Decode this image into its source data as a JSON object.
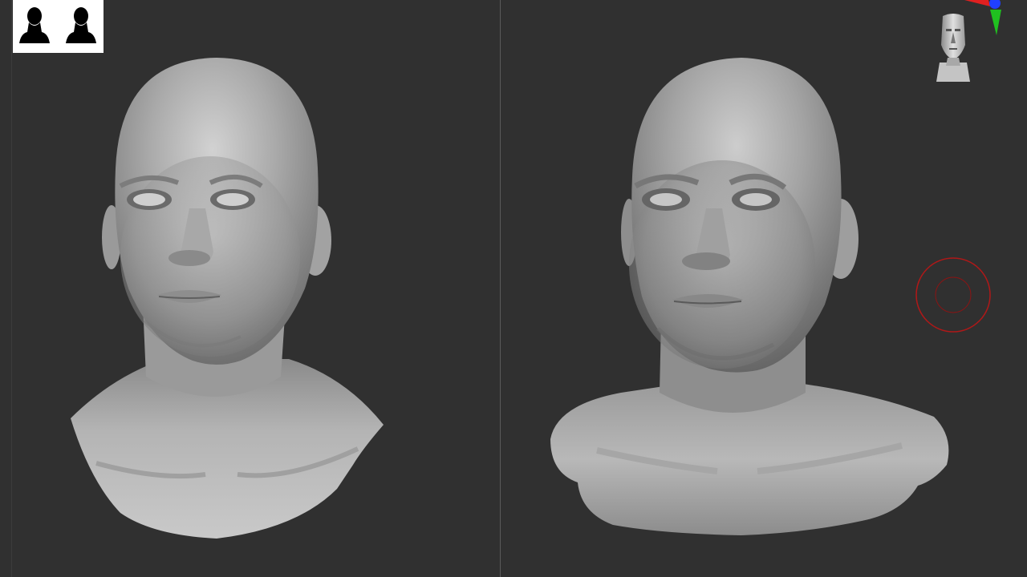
{
  "app": {
    "background": "#303030",
    "divider_color": "#5a5a5a"
  },
  "badge": {
    "icon": "two-person-silhouettes-icon",
    "background": "#ffffff"
  },
  "viewports": [
    {
      "id": "left",
      "content": "bust-detailed-sculpt"
    },
    {
      "id": "right",
      "content": "bust-smooth-sculpt"
    }
  ],
  "gizmo": {
    "icon": "axis-gizmo-icon",
    "axis_colors": {
      "x": "#e02020",
      "y": "#20c020",
      "z": "#2040ff"
    }
  },
  "nav_head": {
    "icon": "navigation-head-icon"
  },
  "brush_cursor": {
    "icon": "brush-cursor-icon",
    "color": "#b01818"
  }
}
